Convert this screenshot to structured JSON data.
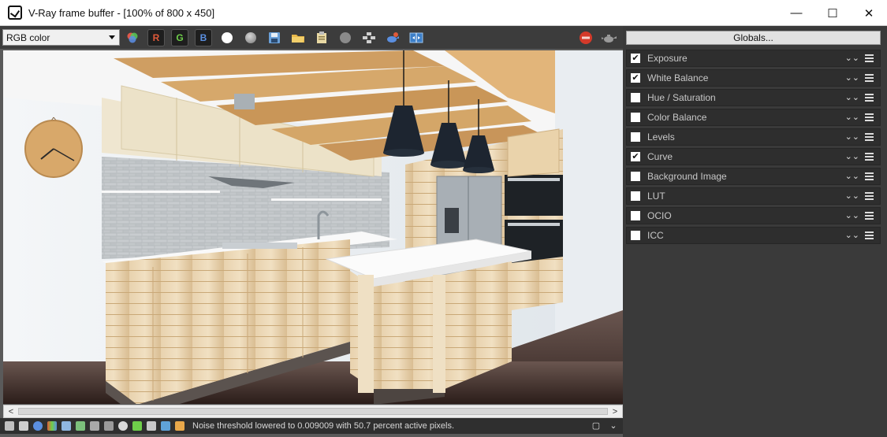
{
  "window": {
    "title": "V-Ray frame buffer - [100% of 800 x 450]",
    "controls": {
      "minimize": "—",
      "maximize": "☐",
      "close": "✕"
    }
  },
  "toolbar": {
    "channel_value": "RGB color",
    "channel_r": "R",
    "channel_g": "G",
    "channel_b": "B",
    "icons": [
      "color-wheel-icon",
      "white-dot-icon",
      "gray-dot-icon",
      "save-icon",
      "open-folder-icon",
      "clipboard-icon",
      "clear-icon",
      "region-icon",
      "teapot-render-icon",
      "compare-icon",
      "stop-icon",
      "teapot-icon"
    ],
    "colors": {
      "red": "#e05a3a",
      "green": "#6fcf4a",
      "blue": "#5b8fe0",
      "stop": "#d43a2a"
    }
  },
  "right_panel": {
    "globals_label": "Globals...",
    "layers": [
      {
        "label": "Exposure",
        "checked": true
      },
      {
        "label": "White Balance",
        "checked": true
      },
      {
        "label": "Hue / Saturation",
        "checked": false
      },
      {
        "label": "Color Balance",
        "checked": false
      },
      {
        "label": "Levels",
        "checked": false
      },
      {
        "label": "Curve",
        "checked": true
      },
      {
        "label": "Background Image",
        "checked": false
      },
      {
        "label": "LUT",
        "checked": false
      },
      {
        "label": "OCIO",
        "checked": false
      },
      {
        "label": "ICC",
        "checked": false
      }
    ]
  },
  "status": {
    "message": "Noise threshold lowered to 0.009009 with 50.7 percent active pixels."
  },
  "scroll": {
    "left": "<",
    "right": ">"
  }
}
